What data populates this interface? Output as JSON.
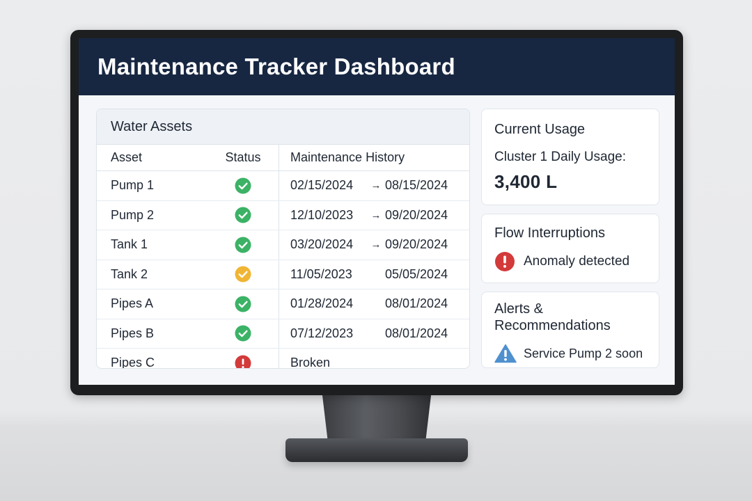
{
  "header": {
    "title": "Maintenance Tracker Dashboard"
  },
  "assets": {
    "title": "Water Assets",
    "columns": [
      "Asset",
      "Status",
      "Maintenance History"
    ],
    "rows": [
      {
        "asset": "Pump 1",
        "status": "ok",
        "from": "02/15/2024",
        "arrow": "→",
        "to": "08/15/2024"
      },
      {
        "asset": "Pump 2",
        "status": "ok",
        "from": "12/10/2023",
        "arrow": "→",
        "to": "09/20/2024"
      },
      {
        "asset": "Tank 1",
        "status": "ok",
        "from": "03/20/2024",
        "arrow": "→",
        "to": "09/20/2024"
      },
      {
        "asset": "Tank 2",
        "status": "warning",
        "from": "11/05/2023",
        "arrow": "",
        "to": "05/05/2024"
      },
      {
        "asset": "Pipes A",
        "status": "ok",
        "from": "01/28/2024",
        "arrow": "",
        "to": "08/01/2024"
      },
      {
        "asset": "Pipes B",
        "status": "ok",
        "from": "07/12/2023",
        "arrow": "",
        "to": "08/01/2024"
      },
      {
        "asset": "Pipes C",
        "status": "error",
        "from": "Broken",
        "arrow": "",
        "to": ""
      }
    ]
  },
  "usage": {
    "title": "Current Usage",
    "label": "Cluster 1 Daily Usage:",
    "value": "3,400 L"
  },
  "flow": {
    "title": "Flow Interruptions",
    "message": "Anomaly detected",
    "icon": "error-circle-icon"
  },
  "alerts": {
    "title": "Alerts & Recommendations",
    "message": "Service Pump 2 soon",
    "icon": "warning-triangle-icon"
  },
  "colors": {
    "header_bg": "#172742",
    "ok": "#3bb265",
    "warning": "#f0b534",
    "error": "#d33a3a",
    "info_triangle": "#4f90cf"
  }
}
